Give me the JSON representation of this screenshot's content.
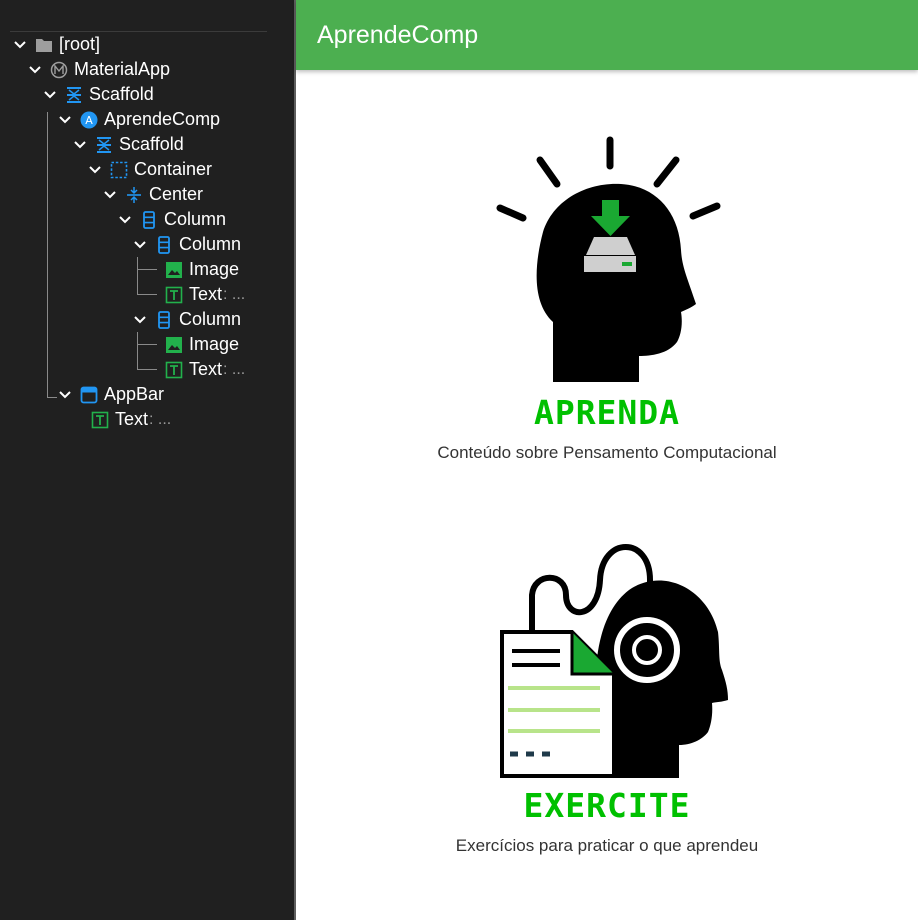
{
  "inspector": {
    "nodes": [
      {
        "label": "[root]",
        "icon": "folder-icon"
      },
      {
        "label": "MaterialApp",
        "icon": "material-app-icon"
      },
      {
        "label": "Scaffold",
        "icon": "scaffold-icon"
      },
      {
        "label": "AprendeComp",
        "icon": "custom-widget-icon"
      },
      {
        "label": "Scaffold",
        "icon": "scaffold-icon"
      },
      {
        "label": "Container",
        "icon": "container-icon"
      },
      {
        "label": "Center",
        "icon": "center-icon"
      },
      {
        "label": "Column",
        "icon": "column-icon"
      },
      {
        "label": "Column",
        "icon": "column-icon"
      },
      {
        "label": "Image",
        "icon": "image-icon"
      },
      {
        "label": "Text",
        "suffix": ": ...",
        "icon": "text-icon"
      },
      {
        "label": "Column",
        "icon": "column-icon"
      },
      {
        "label": "Image",
        "icon": "image-icon"
      },
      {
        "label": "Text",
        "suffix": ": ...",
        "icon": "text-icon"
      },
      {
        "label": "AppBar",
        "icon": "appbar-icon"
      },
      {
        "label": "Text",
        "suffix": ": ...",
        "icon": "text-icon"
      }
    ]
  },
  "app": {
    "title": "AprendeComp",
    "sections": [
      {
        "heading": "APRENDA",
        "caption": "Conteúdo sobre Pensamento Computacional",
        "image": "learning-head-icon"
      },
      {
        "heading": "EXERCITE",
        "caption": "Exercícios para praticar o que aprendeu",
        "image": "exercise-head-icon"
      }
    ]
  },
  "colors": {
    "appbar": "#4caf50",
    "accent_green": "#00c000",
    "inspector_bg": "#202020",
    "icon_blue": "#2196f3",
    "icon_green": "#22b14c"
  }
}
